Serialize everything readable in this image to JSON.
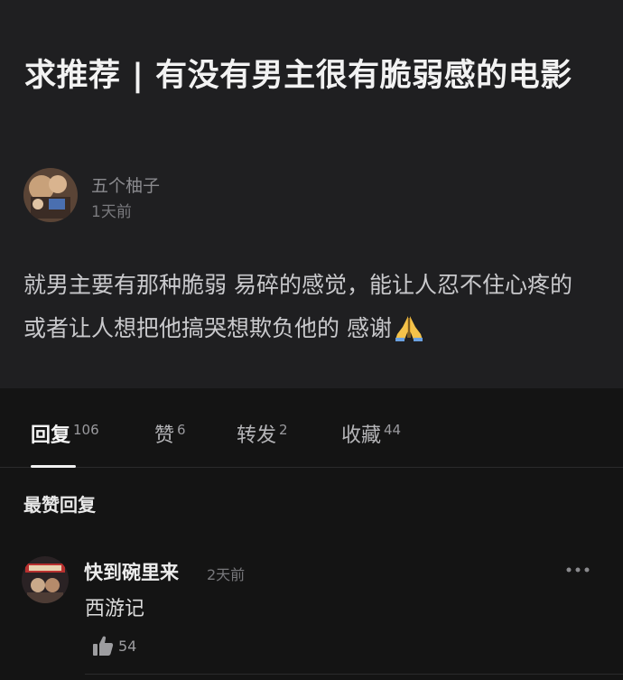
{
  "post": {
    "title": "求推荐 | 有没有男主很有脆弱感的电影",
    "author": {
      "name": "五个柚子",
      "time": "1天前"
    },
    "body": "就男主要有那种脆弱 易碎的感觉，能让人忍不住心疼的 或者让人想把他搞哭想欺负他的 感谢",
    "body_emoji": "pray-emoji"
  },
  "tabs": [
    {
      "label": "回复",
      "count": "106",
      "active": true
    },
    {
      "label": "赞",
      "count": "6",
      "active": false
    },
    {
      "label": "转发",
      "count": "2",
      "active": false
    },
    {
      "label": "收藏",
      "count": "44",
      "active": false
    }
  ],
  "section": {
    "title": "最赞回复"
  },
  "comments": [
    {
      "user": "快到碗里来",
      "time": "2天前",
      "text": "西游记",
      "likes": "54"
    }
  ],
  "colors": {
    "background": "#141414",
    "post_background": "#1f1f21",
    "text_primary": "#f2f2f2",
    "text_secondary": "#8a8a8e"
  }
}
